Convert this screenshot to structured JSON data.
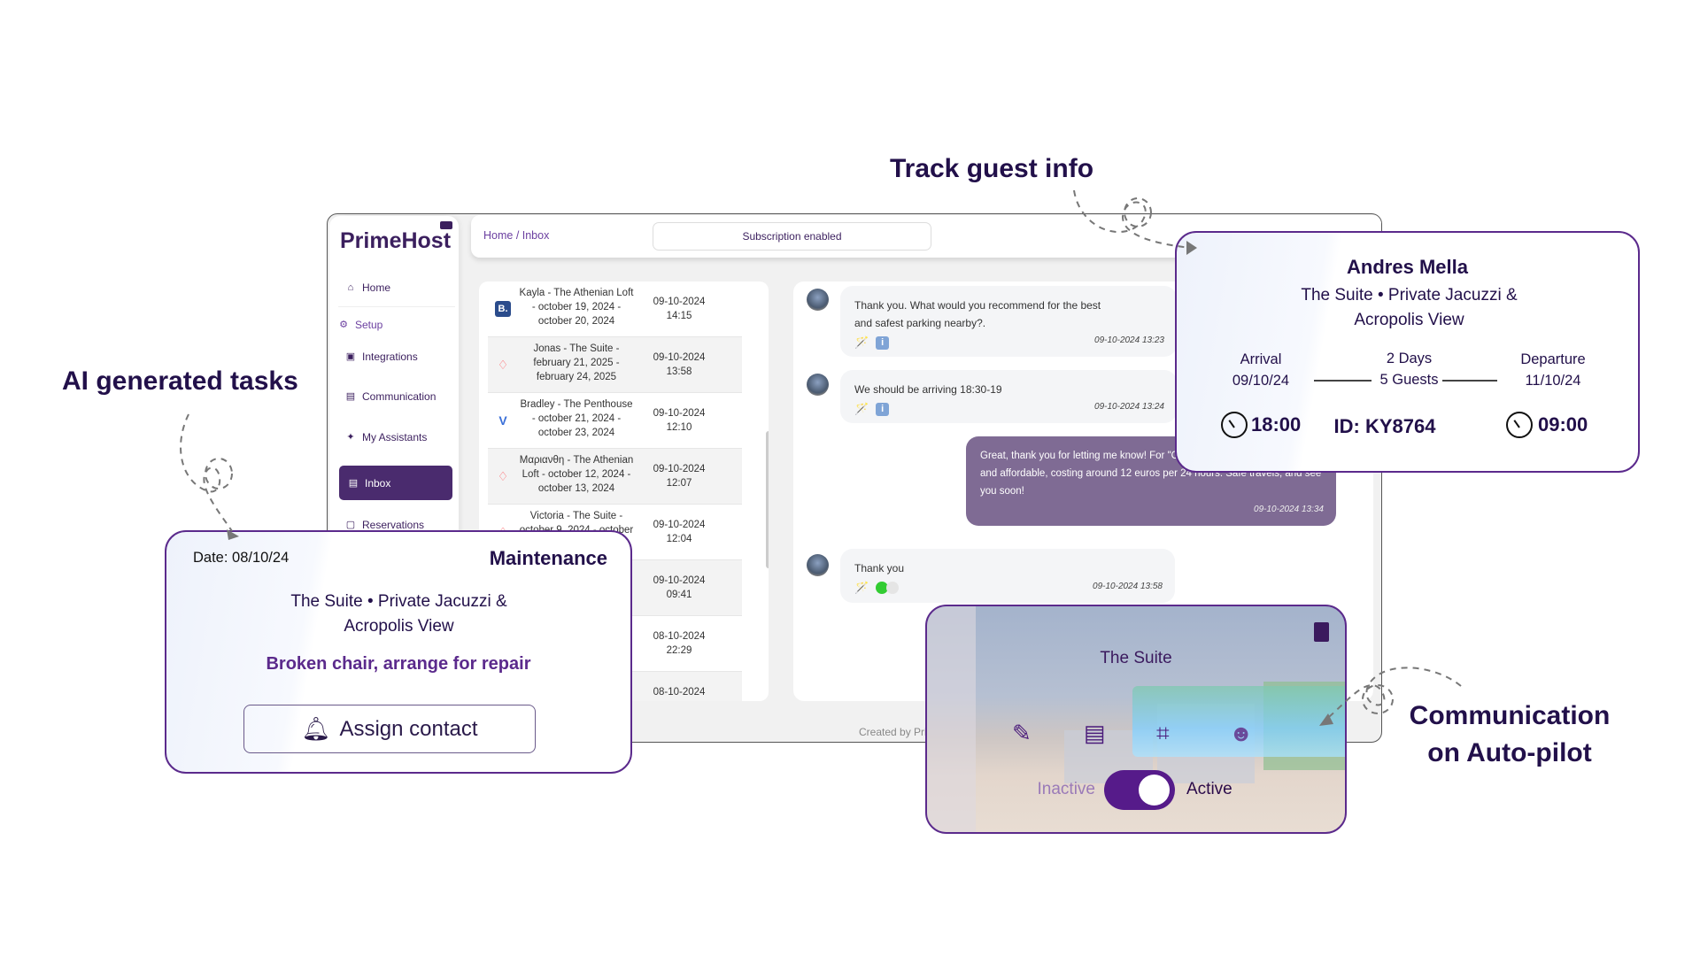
{
  "annotations": {
    "track": "Track guest info",
    "ai": "AI generated tasks",
    "comm1": "Communication",
    "comm2": "on Auto-pilot"
  },
  "app": {
    "logo": "PrimeHost",
    "nav": [
      {
        "label": "Home",
        "icon": "home-icon"
      },
      {
        "label": "Setup",
        "icon": "user-gear-icon"
      },
      {
        "label": "Integrations",
        "icon": "plug-icon"
      },
      {
        "label": "Communication",
        "icon": "chat-icon"
      },
      {
        "label": "My Assistants",
        "icon": "magic-wand-icon"
      },
      {
        "label": "Inbox",
        "icon": "inbox-icon"
      },
      {
        "label": "Reservations",
        "icon": "calendar-icon"
      }
    ],
    "breadcrumb": "Home / Inbox",
    "subscription": "Subscription enabled",
    "footer": "Created by PrimeHost",
    "conversations": [
      {
        "title": "Kayla - The Athenian Loft - october 19, 2024 - october 20, 2024",
        "date": "09-10-2024",
        "time": "14:15",
        "source": "booking"
      },
      {
        "title": "Jonas - The Suite - february 21, 2025 - february 24, 2025",
        "date": "09-10-2024",
        "time": "13:58",
        "source": "airbnb"
      },
      {
        "title": "Bradley - The Penthouse - october 21, 2024 - october 23, 2024",
        "date": "09-10-2024",
        "time": "12:10",
        "source": "vrbo"
      },
      {
        "title": "Μαριανθη - The Athenian Loft - october 12, 2024 - october 13, 2024",
        "date": "09-10-2024",
        "time": "12:07",
        "source": "airbnb"
      },
      {
        "title": "Victoria - The Suite - october 9, 2024 - october",
        "date": "09-10-2024",
        "time": "12:04",
        "source": "airbnb"
      },
      {
        "title": "",
        "date": "09-10-2024",
        "time": "09:41",
        "source": ""
      },
      {
        "title": "",
        "date": "08-10-2024",
        "time": "22:29",
        "source": ""
      },
      {
        "title": "",
        "date": "08-10-2024",
        "time": "",
        "source": ""
      }
    ],
    "messages": [
      {
        "text": "Thank you. What would you recommend for the best and safest parking nearby?.",
        "ts": "09-10-2024 13:23"
      },
      {
        "text": "We should be arriving 18:30-19",
        "ts": "09-10-2024 13:24"
      },
      {
        "text": "Great, thank you for letting me know! For \"Chiou 2 garage\" nearby. It's secure and affordable, costing around 12 euros per 24 hours. Safe travels, and see you soon!",
        "ts": "09-10-2024 13:34"
      },
      {
        "text": "Thank you",
        "ts": "09-10-2024 13:58"
      }
    ]
  },
  "guest": {
    "name": "Andres Mella",
    "property": "The Suite • Private Jacuzzi & Acropolis View",
    "arrival_label": "Arrival",
    "arrival_date": "09/10/24",
    "days": "2 Days",
    "guests": "5 Guests",
    "departure_label": "Departure",
    "departure_date": "11/10/24",
    "arrival_time": "18:00",
    "id": "ID: KY8764",
    "departure_time": "09:00"
  },
  "task": {
    "date": "Date: 08/10/24",
    "category": "Maintenance",
    "property": "The Suite • Private Jacuzzi & Acropolis View",
    "task": "Broken chair, arrange for repair",
    "button": "Assign contact"
  },
  "autopilot": {
    "title": "The Suite",
    "inactive": "Inactive",
    "active": "Active",
    "toggle_on": true
  },
  "colors": {
    "brand": "#3b1f5e",
    "accent": "#5b2a8c",
    "outgoing": "#7f6b94"
  }
}
